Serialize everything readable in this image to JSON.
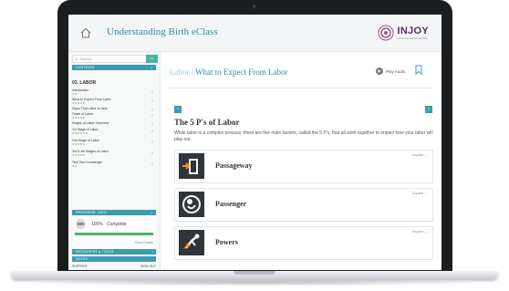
{
  "app": {
    "title": "Understanding Birth eClass",
    "logo_word": "INJOY",
    "logo_sub": "HEALTH EDUCATION"
  },
  "sidebar": {
    "search_placeholder": "Q. Search",
    "search_button": "Go",
    "contents_label": "CONTENTS",
    "chapter": "03. LABOR",
    "lessons": [
      {
        "label": "Introduction",
        "stars": "★★"
      },
      {
        "label": "What to Expect From Labor",
        "stars": "★★★★★"
      },
      {
        "label": "Signs That Labor Is Near",
        "stars": ""
      },
      {
        "label": "Onset of Labor",
        "stars": "★★★★★"
      },
      {
        "label": "Stages of Labor Overview",
        "stars": ""
      },
      {
        "label": "1st Stage of Labor",
        "stars": "★★★★★★"
      },
      {
        "label": "2nd Stage of Labor",
        "stars": "★★★★★"
      },
      {
        "label": "3rd & 4th Stages of Labor",
        "stars": "★★★★★"
      },
      {
        "label": "Test Your Knowledge",
        "stars": "★★"
      }
    ],
    "progress_label": "PROGRESS: 100%",
    "progress_fraction": 1.0,
    "avatar": "EM",
    "percent": "100%",
    "complete": "Complete",
    "show_details": "Show Details",
    "resources_label": "RESOURCES & TOOLS",
    "notes_label": "NOTES",
    "support": "SUPPORT",
    "sign_out": "SIGN OUT"
  },
  "main": {
    "crumb_section": "Labor",
    "crumb_sep": "/",
    "crumb_page": "What to Expect From Labor",
    "play_audio": "Play Audio",
    "heading": "The 5 P's of Labor",
    "intro": "While labor is a complex process, there are five main factors, called the 5 P's, that all work together to impact how your labor will play out.",
    "cards": [
      {
        "title": "Passageway",
        "expand": "Expand ⌄",
        "icon": "door-arrow-icon"
      },
      {
        "title": "Passenger",
        "expand": "Expand ⌄",
        "icon": "baby-icon"
      },
      {
        "title": "Powers",
        "expand": "Expand ⌄",
        "icon": "superhero-icon"
      }
    ]
  },
  "colors": {
    "accent": "#2b8fa0",
    "sidebar_bar": "#3d9bb0",
    "success": "#4cb26a",
    "logo": "#5b2c6f"
  }
}
